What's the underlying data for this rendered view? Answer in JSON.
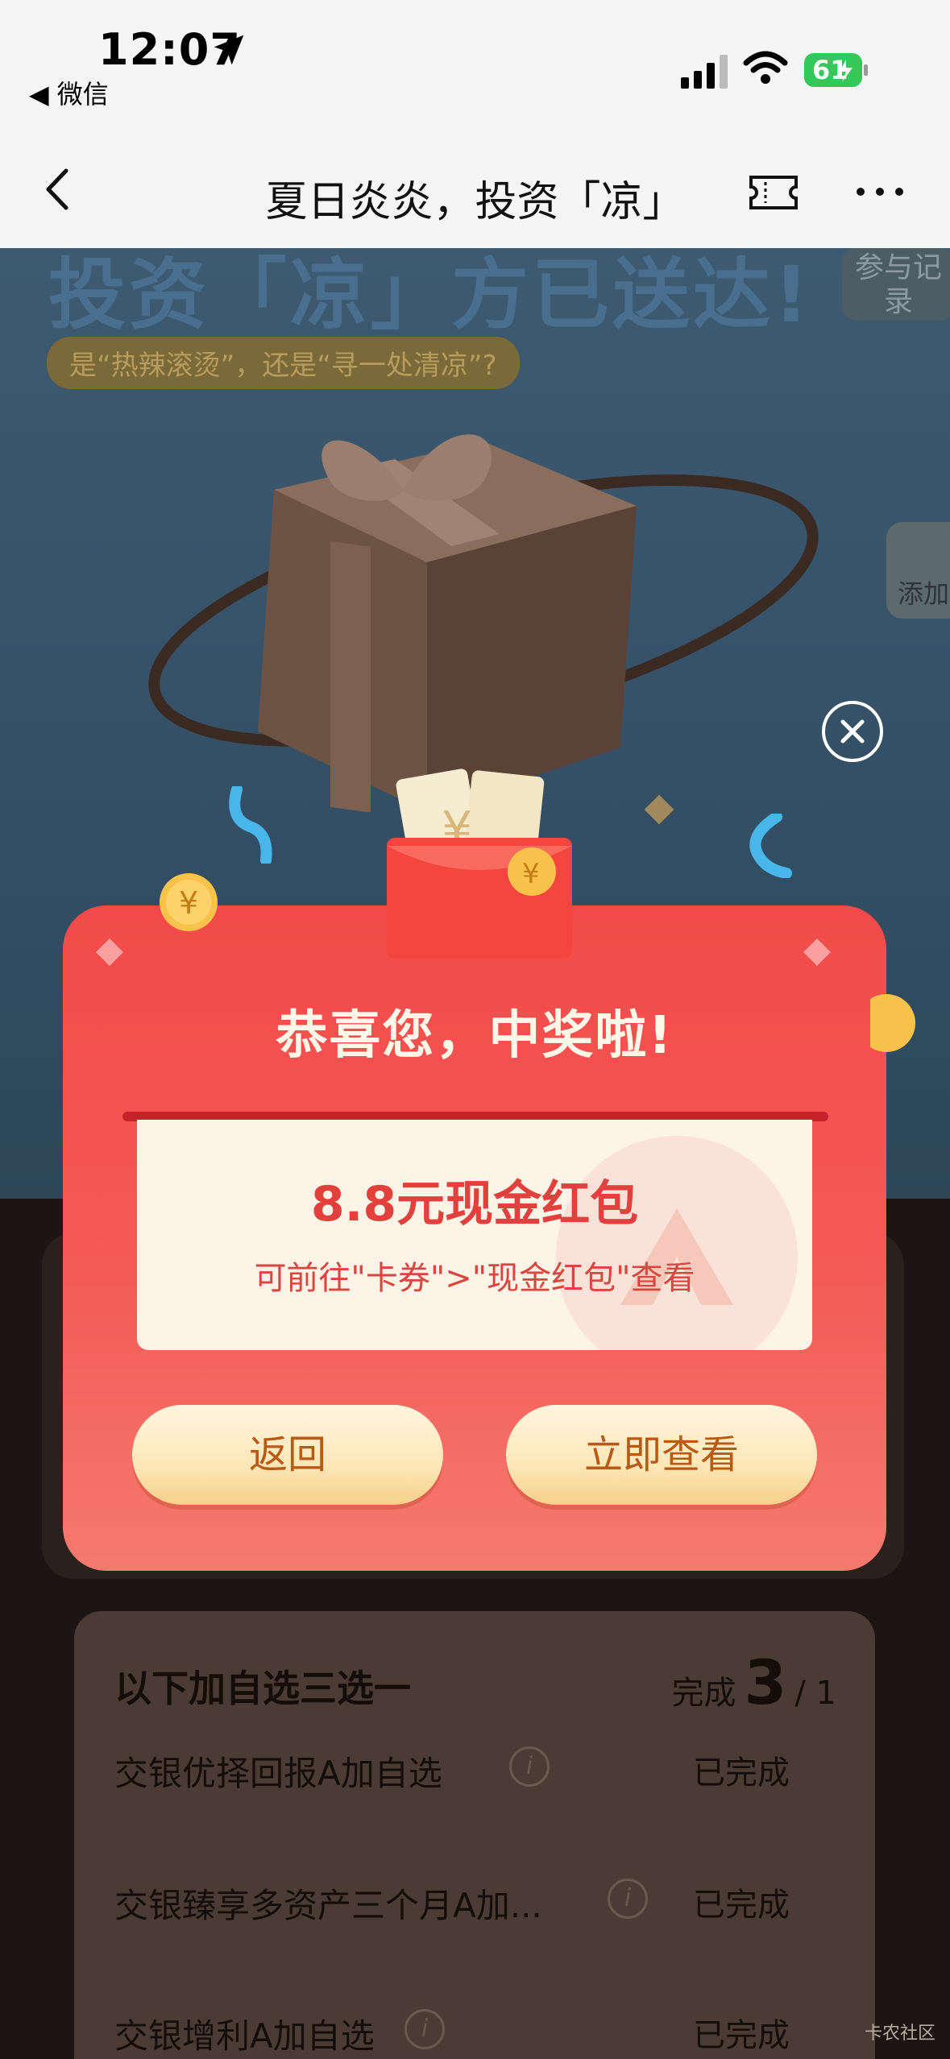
{
  "status_bar": {
    "time": "12:07",
    "back_app": "◀ 微信",
    "battery": "61"
  },
  "nav": {
    "title": "夏日炎炎，投资「凉」"
  },
  "hero": {
    "title": "投资「凉」方已送达!",
    "subtitle": "是“热辣滚烫”，还是“寻一处清凉”?",
    "record_label": "参与记录",
    "add_label": "添加"
  },
  "modal": {
    "title": "恭喜您，中奖啦!",
    "prize_amount": "8.8元现金红包",
    "prize_hint": "可前往\"卡券\">\"现金红包\"查看",
    "back_button": "返回",
    "view_button": "立即查看"
  },
  "tasks": {
    "heading": "以下加自选三选一",
    "progress_prefix": "完成",
    "progress_done": "3",
    "progress_total": "/ 1",
    "items": [
      {
        "name": "交银优择回报A加自选",
        "status": "已完成"
      },
      {
        "name": "交银臻享多资产三个月A加...",
        "status": "已完成"
      },
      {
        "name": "交银增利A加自选",
        "status": "已完成"
      }
    ]
  },
  "watermark": "卡农社区",
  "colors": {
    "modal_red": "#f24a4a",
    "button_gold": "#fde7b8",
    "button_text": "#b95a14",
    "prize_red": "#e2403c"
  }
}
